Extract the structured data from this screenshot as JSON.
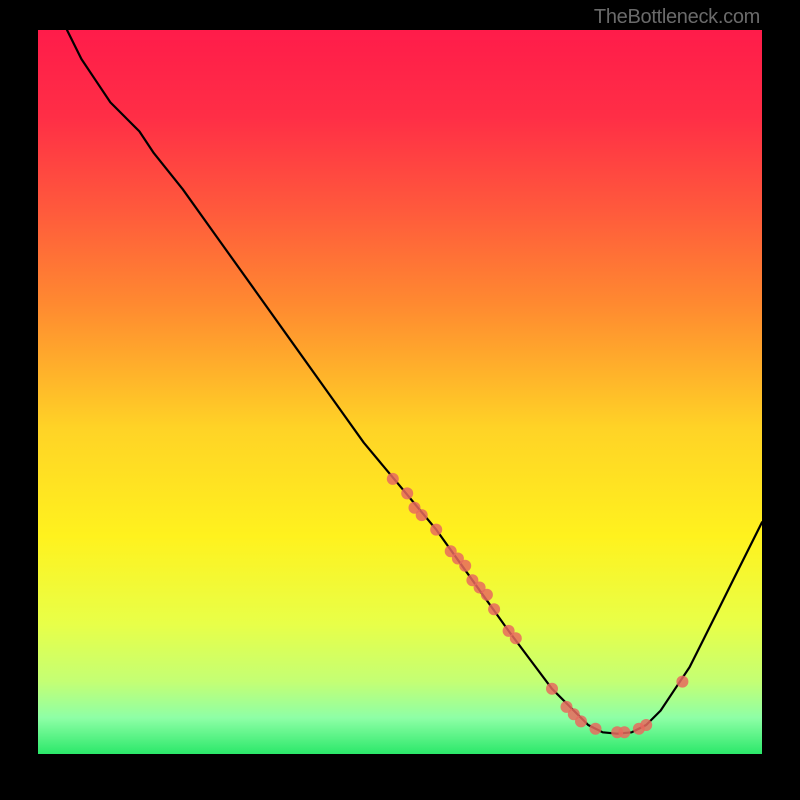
{
  "attribution": "TheBottleneck.com",
  "chart_data": {
    "type": "line",
    "xlim": [
      0,
      100
    ],
    "ylim": [
      0,
      100
    ],
    "title": "",
    "xlabel": "",
    "ylabel": "",
    "background": {
      "type": "vertical-gradient",
      "stops": [
        {
          "offset": 0.0,
          "color": "#ff1c4a"
        },
        {
          "offset": 0.12,
          "color": "#ff2e46"
        },
        {
          "offset": 0.25,
          "color": "#ff5a3c"
        },
        {
          "offset": 0.38,
          "color": "#ff8a30"
        },
        {
          "offset": 0.55,
          "color": "#ffd326"
        },
        {
          "offset": 0.7,
          "color": "#fff21e"
        },
        {
          "offset": 0.82,
          "color": "#e8ff48"
        },
        {
          "offset": 0.9,
          "color": "#c4ff74"
        },
        {
          "offset": 0.95,
          "color": "#8effa6"
        },
        {
          "offset": 1.0,
          "color": "#2be86a"
        }
      ]
    },
    "series": [
      {
        "name": "bottleneck-curve",
        "color": "#000000",
        "width": 2.2,
        "points": [
          {
            "x": 4,
            "y": 100
          },
          {
            "x": 6,
            "y": 96
          },
          {
            "x": 8,
            "y": 93
          },
          {
            "x": 10,
            "y": 90
          },
          {
            "x": 12,
            "y": 88
          },
          {
            "x": 14,
            "y": 86
          },
          {
            "x": 16,
            "y": 83
          },
          {
            "x": 20,
            "y": 78
          },
          {
            "x": 25,
            "y": 71
          },
          {
            "x": 30,
            "y": 64
          },
          {
            "x": 35,
            "y": 57
          },
          {
            "x": 40,
            "y": 50
          },
          {
            "x": 45,
            "y": 43
          },
          {
            "x": 50,
            "y": 37
          },
          {
            "x": 55,
            "y": 31
          },
          {
            "x": 60,
            "y": 24
          },
          {
            "x": 65,
            "y": 17
          },
          {
            "x": 68,
            "y": 13
          },
          {
            "x": 71,
            "y": 9
          },
          {
            "x": 74,
            "y": 6
          },
          {
            "x": 76,
            "y": 4
          },
          {
            "x": 78,
            "y": 3
          },
          {
            "x": 80,
            "y": 2.8
          },
          {
            "x": 82,
            "y": 3
          },
          {
            "x": 84,
            "y": 4
          },
          {
            "x": 86,
            "y": 6
          },
          {
            "x": 88,
            "y": 9
          },
          {
            "x": 90,
            "y": 12
          },
          {
            "x": 92,
            "y": 16
          },
          {
            "x": 94,
            "y": 20
          },
          {
            "x": 96,
            "y": 24
          },
          {
            "x": 98,
            "y": 28
          },
          {
            "x": 100,
            "y": 32
          }
        ]
      }
    ],
    "markers": {
      "name": "data-points",
      "color": "#e86a5e",
      "radius": 6,
      "points": [
        {
          "x": 49,
          "y": 38
        },
        {
          "x": 51,
          "y": 36
        },
        {
          "x": 52,
          "y": 34
        },
        {
          "x": 53,
          "y": 33
        },
        {
          "x": 55,
          "y": 31
        },
        {
          "x": 57,
          "y": 28
        },
        {
          "x": 58,
          "y": 27
        },
        {
          "x": 59,
          "y": 26
        },
        {
          "x": 60,
          "y": 24
        },
        {
          "x": 61,
          "y": 23
        },
        {
          "x": 62,
          "y": 22
        },
        {
          "x": 63,
          "y": 20
        },
        {
          "x": 65,
          "y": 17
        },
        {
          "x": 66,
          "y": 16
        },
        {
          "x": 71,
          "y": 9
        },
        {
          "x": 73,
          "y": 6.5
        },
        {
          "x": 74,
          "y": 5.5
        },
        {
          "x": 75,
          "y": 4.5
        },
        {
          "x": 77,
          "y": 3.5
        },
        {
          "x": 80,
          "y": 3
        },
        {
          "x": 81,
          "y": 3
        },
        {
          "x": 83,
          "y": 3.5
        },
        {
          "x": 84,
          "y": 4
        },
        {
          "x": 89,
          "y": 10
        }
      ]
    }
  }
}
